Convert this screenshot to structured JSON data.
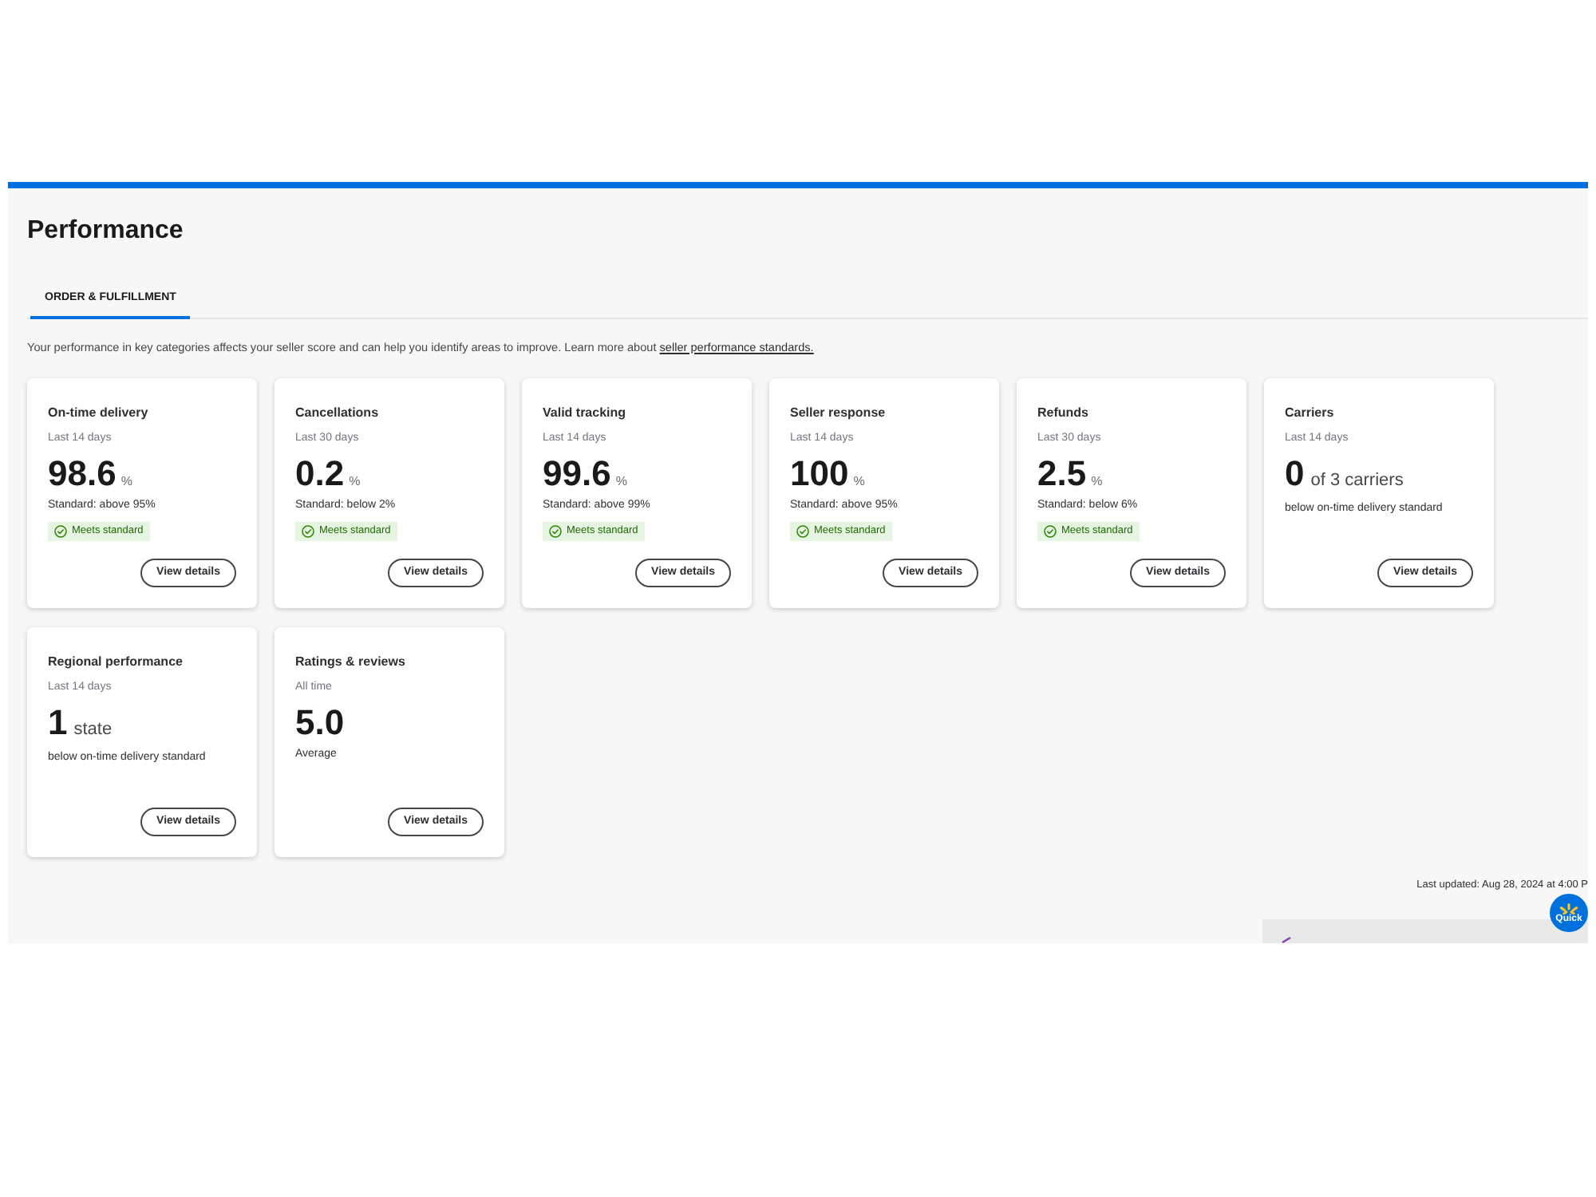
{
  "page": {
    "title": "Performance"
  },
  "tabs": [
    {
      "label": "ORDER & FULFILLMENT",
      "selected": true
    }
  ],
  "intro": {
    "text": "Your performance in key categories affects your seller score and can help you identify areas to improve. Learn more about",
    "link": "seller performance standards."
  },
  "cards": [
    {
      "kind": "rate",
      "title": "On-time delivery",
      "period": "Last 14 days",
      "value": "98.6",
      "unit": "%",
      "note": "Standard: above 95%",
      "badge": "Meets standard",
      "button": "View details"
    },
    {
      "kind": "rate",
      "title": "Cancellations",
      "period": "Last 30 days",
      "value": "0.2",
      "unit": "%",
      "note": "Standard: below 2%",
      "badge": "Meets standard",
      "button": "View details"
    },
    {
      "kind": "rate",
      "title": "Valid tracking",
      "period": "Last 14 days",
      "value": "99.6",
      "unit": "%",
      "note": "Standard: above 99%",
      "badge": "Meets standard",
      "button": "View details"
    },
    {
      "kind": "rate",
      "title": "Seller response",
      "period": "Last 14 days",
      "value": "100",
      "unit": "%",
      "note": "Standard: above 95%",
      "badge": "Meets standard",
      "button": "View details"
    },
    {
      "kind": "rate",
      "title": "Refunds",
      "period": "Last 30 days",
      "value": "2.5",
      "unit": "%",
      "note": "Standard: below 6%",
      "badge": "Meets standard",
      "button": "View details"
    },
    {
      "kind": "count",
      "title": "Carriers",
      "period": "Last 14 days",
      "value": "0",
      "unit": "of 3 carriers",
      "note": "below on-time delivery standard",
      "button": "View details"
    },
    {
      "kind": "count",
      "title": "Regional performance",
      "period": "Last 14 days",
      "value": "1",
      "unit": "state",
      "note": "below on-time delivery standard",
      "button": "View details"
    },
    {
      "kind": "average",
      "title": "Ratings & reviews",
      "period": "All time",
      "value": "5.0",
      "note": "Average",
      "button": "View details"
    }
  ],
  "footer": {
    "last_updated": "Last updated: Aug 28, 2024 at 4:00 P"
  },
  "quick_button": {
    "label": "Quick"
  }
}
